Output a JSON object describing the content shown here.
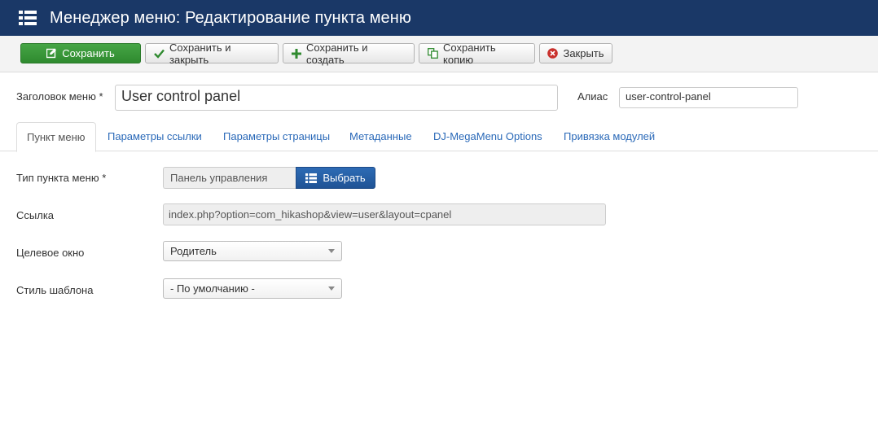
{
  "header": {
    "title": "Менеджер меню: Редактирование пункта меню",
    "icon": "menu-list-icon"
  },
  "toolbar": {
    "save_label": "Сохранить",
    "save_close_label": "Сохранить и закрыть",
    "save_new_label": "Сохранить и создать",
    "save_copy_label": "Сохранить копию",
    "close_label": "Закрыть",
    "colors": {
      "save": "#46a546",
      "close_icon": "#c9302c",
      "check_icon": "#2f8a2f"
    }
  },
  "form": {
    "title_label": "Заголовок меню *",
    "title_value": "User control panel",
    "alias_label": "Алиас",
    "alias_value": "user-control-panel"
  },
  "tabs": [
    {
      "label": "Пункт меню",
      "active": true
    },
    {
      "label": "Параметры ссылки",
      "active": false
    },
    {
      "label": "Параметры страницы",
      "active": false
    },
    {
      "label": "Метаданные",
      "active": false
    },
    {
      "label": "DJ-MegaMenu Options",
      "active": false
    },
    {
      "label": "Привязка модулей",
      "active": false
    }
  ],
  "details": {
    "type_label": "Тип пункта меню *",
    "type_value": "Панель управления",
    "choose_label": "Выбрать",
    "link_label": "Ссылка",
    "link_value": "index.php?option=com_hikashop&view=user&layout=cpanel",
    "target_label": "Целевое окно",
    "target_value": "Родитель",
    "style_label": "Стиль шаблона",
    "style_value": "- По умолчанию -"
  },
  "colors": {
    "header_bg": "#1a3867",
    "link": "#2a69b8",
    "primary_btn": "#1f5395"
  }
}
